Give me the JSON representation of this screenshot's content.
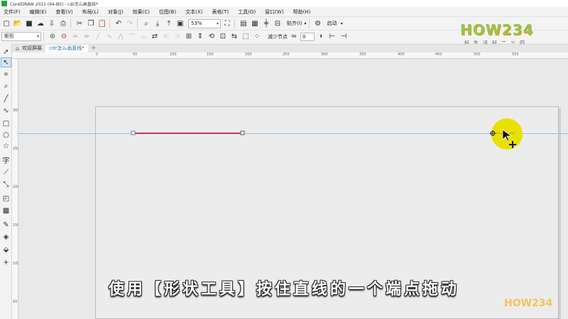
{
  "window": {
    "title": "CorelDRAW 2021 (64-Bit) - cdr怎么画直线*"
  },
  "menu": [
    "文件(F)",
    "编辑(E)",
    "查看(V)",
    "布局(L)",
    "对象(J)",
    "效果(C)",
    "位图(B)",
    "文本(X)",
    "表格(T)",
    "工具(O)",
    "窗口(W)",
    "帮助(H)"
  ],
  "toolbar": {
    "zoom": "53%",
    "snap_label": "贴齐(I)",
    "launch_label": "启动"
  },
  "property_bar": {
    "shape_mode": "矩形",
    "reduce_nodes_label": "减少节点",
    "smoothness_value": "0"
  },
  "tabs": [
    {
      "label": "欢迎屏幕",
      "active": false
    },
    {
      "label": "cdr怎么画直线*",
      "active": true
    }
  ],
  "ruler": {
    "top_ticks": [
      "0",
      "50",
      "100",
      "150",
      "200",
      "250",
      "300",
      "350",
      "400",
      "450",
      "500",
      "550"
    ],
    "left_ticks": [
      "300",
      "250",
      "200",
      "150",
      "100",
      "50"
    ]
  },
  "logo": {
    "text": "HOW234",
    "tagline": "好生活好二三四"
  },
  "watermark": "HOW234",
  "subtitle": "使用【形状工具】按住直线的一个端点拖动",
  "colors": {
    "line": "#c23a5a",
    "guide": "#8cc0e8",
    "cursor_highlight": "#e8e000",
    "logo_green": "#8fc94a",
    "logo_orange": "#f08a2a"
  }
}
